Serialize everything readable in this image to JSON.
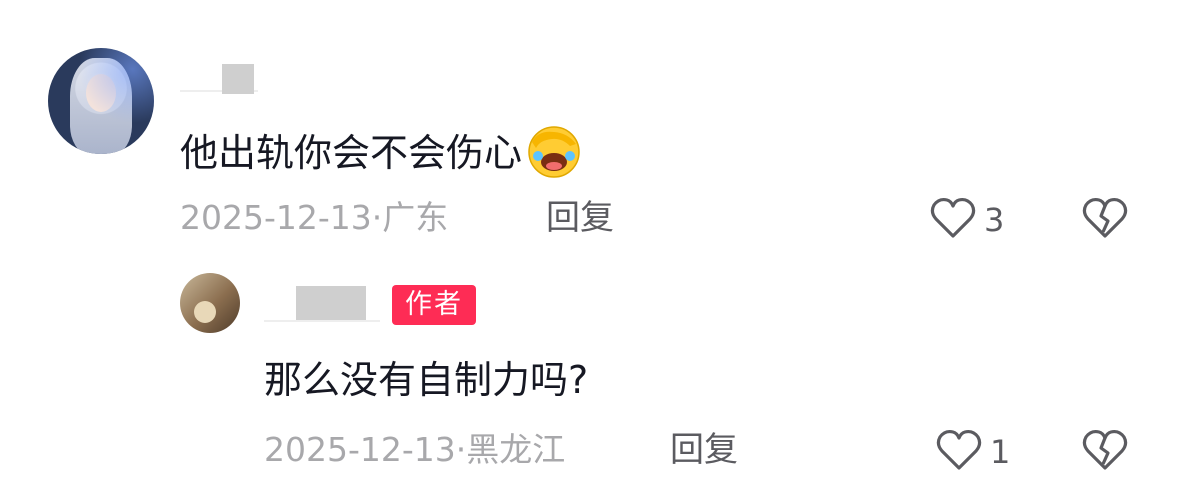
{
  "comments": [
    {
      "text": "他出轨你会不会伤心",
      "emoji": "facepalm-laugh-emoji",
      "date": "2025-12-13",
      "separator": "·",
      "location": "广东",
      "reply_label": "回复",
      "like_count": "3"
    },
    {
      "author_badge": "作者",
      "text": "那么没有自制力吗?",
      "date": "2025-12-13",
      "separator": "·",
      "location": "黑龙江",
      "reply_label": "回复",
      "like_count": "1"
    }
  ],
  "icons": {
    "like": "heart-outline-icon",
    "dislike": "broken-heart-icon"
  },
  "colors": {
    "author_badge": "#fe2c55",
    "meta_text": "#a8a8ab",
    "reply_text": "#5b5b60"
  }
}
